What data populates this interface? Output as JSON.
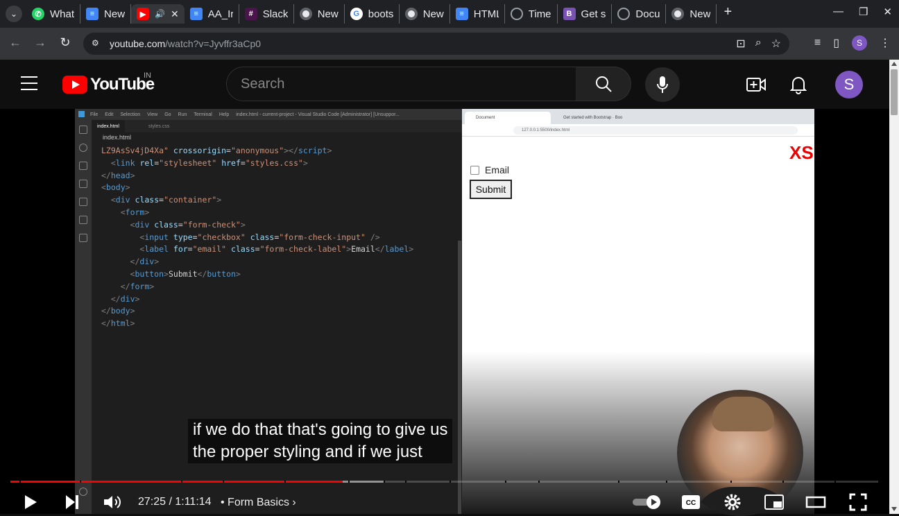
{
  "browser": {
    "tabs": [
      {
        "label": "What",
        "icon": "whatsapp-icon",
        "kind": "wa"
      },
      {
        "label": "New",
        "icon": "google-docs-icon",
        "kind": "doc"
      },
      {
        "label": "",
        "icon": "youtube-icon",
        "kind": "yt",
        "active": true
      },
      {
        "label": "AA_Ir",
        "icon": "google-docs-icon",
        "kind": "doc"
      },
      {
        "label": "Slack",
        "icon": "slack-icon",
        "kind": "slack"
      },
      {
        "label": "New",
        "icon": "chrome-icon",
        "kind": "chrome"
      },
      {
        "label": "boots",
        "icon": "google-icon",
        "kind": "g"
      },
      {
        "label": "New",
        "icon": "chrome-icon",
        "kind": "chrome"
      },
      {
        "label": "HTML",
        "icon": "google-docs-icon",
        "kind": "doc"
      },
      {
        "label": "Time",
        "icon": "globe-icon",
        "kind": "globe"
      },
      {
        "label": "Get s",
        "icon": "bootstrap-icon",
        "kind": "bs"
      },
      {
        "label": "Docu",
        "icon": "globe-icon",
        "kind": "globe"
      },
      {
        "label": "New",
        "icon": "chrome-icon",
        "kind": "chrome"
      }
    ],
    "url_host": "youtube.com",
    "url_path": "/watch?v=Jyvffr3aCp0",
    "profile_initial": "S"
  },
  "youtube": {
    "logo_text": "YouTube",
    "country_code": "IN",
    "search_placeholder": "Search",
    "avatar_initial": "S"
  },
  "video": {
    "vscode_title_items": [
      "File",
      "Edit",
      "Selection",
      "View",
      "Go",
      "Run",
      "Terminal",
      "Help",
      "index.html - current-project - Visual Studio Code [Administrator] [Unsuppor..."
    ],
    "vscode_tabs": [
      "index.html",
      "styles.css"
    ],
    "vscode_breadcrumb": "index.html",
    "preview_tabs": [
      "Document",
      "Get started with Bootstrap · Boo"
    ],
    "preview_url": "127.0.0.1:5500/index.html",
    "preview_badge": "XS",
    "preview_checkbox_label": "Email",
    "preview_button_label": "Submit",
    "captions": [
      "if we do that that's going to give us",
      "the proper styling and if we just"
    ]
  },
  "player": {
    "current_time": "27:25",
    "duration": "1:11:14",
    "time_display": "27:25 / 1:11:14",
    "chapter_title": "Form Basics",
    "progress_played": 0.383,
    "progress_buffered": 0.43
  },
  "colors": {
    "yt_red": "#ff0000",
    "avatar": "#7e57c2",
    "progress": "#ff0000"
  }
}
